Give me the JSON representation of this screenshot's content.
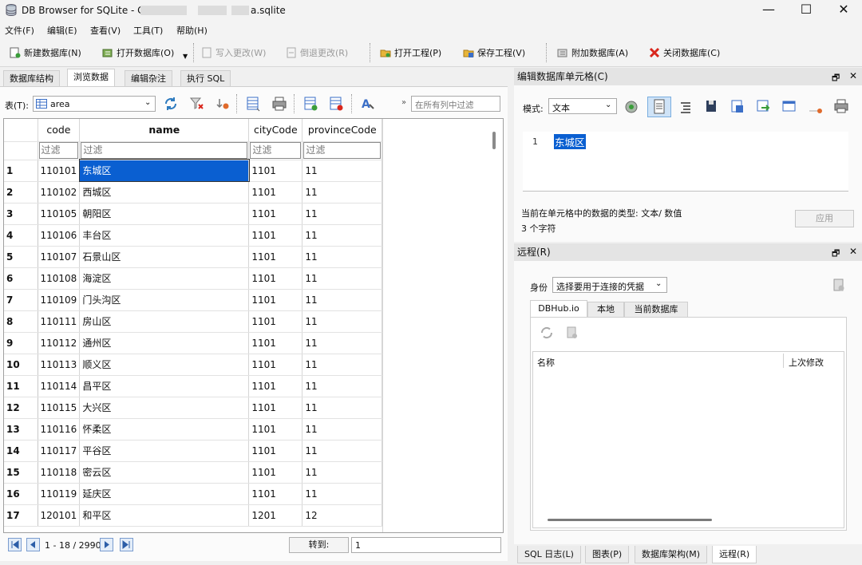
{
  "window": {
    "title_prefix": "DB Browser for SQLite - C:\\",
    "title_suffix": "a.sqlite",
    "minimize": "—",
    "maximize": "☐",
    "close": "✕"
  },
  "menu": [
    "文件(F)",
    "编辑(E)",
    "查看(V)",
    "工具(T)",
    "帮助(H)"
  ],
  "toolbar": {
    "new_db": "新建数据库(N)",
    "open_db": "打开数据库(O)",
    "write_changes": "写入更改(W)",
    "revert_changes": "倒退更改(R)",
    "open_project": "打开工程(P)",
    "save_project": "保存工程(V)",
    "attach_db": "附加数据库(A)",
    "close_db": "关闭数据库(C)"
  },
  "tabs": [
    "数据库结构",
    "浏览数据",
    "编辑杂注",
    "执行 SQL"
  ],
  "browse": {
    "table_label": "表(T):",
    "table_name": "area",
    "filter_all_placeholder": "在所有列中过滤",
    "columns": [
      "code",
      "name",
      "cityCode",
      "provinceCode"
    ],
    "filter_placeholder": "过滤",
    "rows": [
      [
        "1",
        "110101",
        "东城区",
        "1101",
        "11"
      ],
      [
        "2",
        "110102",
        "西城区",
        "1101",
        "11"
      ],
      [
        "3",
        "110105",
        "朝阳区",
        "1101",
        "11"
      ],
      [
        "4",
        "110106",
        "丰台区",
        "1101",
        "11"
      ],
      [
        "5",
        "110107",
        "石景山区",
        "1101",
        "11"
      ],
      [
        "6",
        "110108",
        "海淀区",
        "1101",
        "11"
      ],
      [
        "7",
        "110109",
        "门头沟区",
        "1101",
        "11"
      ],
      [
        "8",
        "110111",
        "房山区",
        "1101",
        "11"
      ],
      [
        "9",
        "110112",
        "通州区",
        "1101",
        "11"
      ],
      [
        "10",
        "110113",
        "顺义区",
        "1101",
        "11"
      ],
      [
        "11",
        "110114",
        "昌平区",
        "1101",
        "11"
      ],
      [
        "12",
        "110115",
        "大兴区",
        "1101",
        "11"
      ],
      [
        "13",
        "110116",
        "怀柔区",
        "1101",
        "11"
      ],
      [
        "14",
        "110117",
        "平谷区",
        "1101",
        "11"
      ],
      [
        "15",
        "110118",
        "密云区",
        "1101",
        "11"
      ],
      [
        "16",
        "110119",
        "延庆区",
        "1101",
        "11"
      ],
      [
        "17",
        "120101",
        "和平区",
        "1201",
        "12"
      ]
    ],
    "record_info": "1 - 18 / 2990",
    "goto_label": "转到:",
    "goto_value": "1"
  },
  "edit_cell": {
    "title": "编辑数据库单元格(C)",
    "mode_label": "模式:",
    "mode_value": "文本",
    "line_no": "1",
    "value": "东城区",
    "type_info": "当前在单元格中的数据的类型: 文本/ 数值",
    "char_count": "3 个字符",
    "apply": "应用"
  },
  "remote": {
    "title": "远程(R)",
    "identity_label": "身份",
    "identity_value": "选择要用于连接的凭据",
    "tabs": [
      "DBHub.io",
      "本地",
      "当前数据库"
    ],
    "col_name": "名称",
    "col_modified": "上次修改"
  },
  "bottom_tabs": [
    "SQL 日志(L)",
    "图表(P)",
    "数据库架构(M)",
    "远程(R)"
  ],
  "colors": {
    "selection": "#0a5fd1",
    "close_red": "#d9261c"
  }
}
